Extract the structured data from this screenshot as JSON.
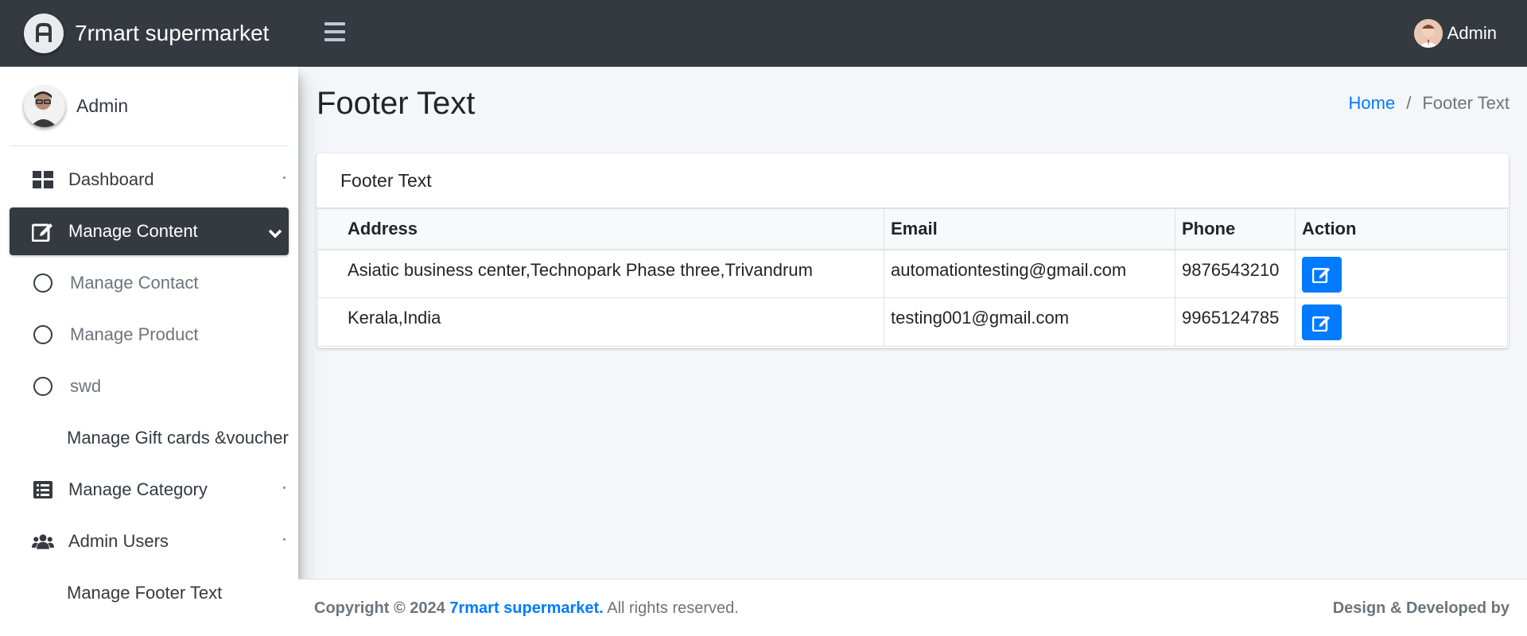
{
  "brand": {
    "name": "7rmart supermarket"
  },
  "topbar": {
    "user_name": "Admin"
  },
  "sidebar": {
    "user_name": "Admin",
    "items": [
      {
        "label": "Dashboard"
      },
      {
        "label": "Manage Content"
      },
      {
        "label": "Manage Contact"
      },
      {
        "label": "Manage Product"
      },
      {
        "label": "swd"
      },
      {
        "label": "Manage Gift cards &voucher"
      },
      {
        "label": "Manage Category"
      },
      {
        "label": "Admin Users"
      },
      {
        "label": "Manage Footer Text"
      }
    ]
  },
  "page": {
    "title": "Footer Text"
  },
  "breadcrumb": {
    "home": "Home",
    "separator": "/",
    "current": "Footer Text"
  },
  "card": {
    "title": "Footer Text",
    "columns": [
      "Address",
      "Email",
      "Phone",
      "Action"
    ],
    "rows": [
      {
        "address": "Asiatic business center,Technopark Phase three,Trivandrum",
        "email": "automationtesting@gmail.com",
        "phone": "9876543210"
      },
      {
        "address": "Kerala,India",
        "email": "testing001@gmail.com",
        "phone": "9965124785"
      }
    ]
  },
  "footer": {
    "copyright_prefix": "Copyright © 2024",
    "brand_link": "7rmart supermarket.",
    "suffix": "All rights reserved.",
    "right": "Design & Developed by"
  },
  "colors": {
    "accent": "#007bff",
    "navbar": "#343a40",
    "background": "#f4f6f9"
  }
}
